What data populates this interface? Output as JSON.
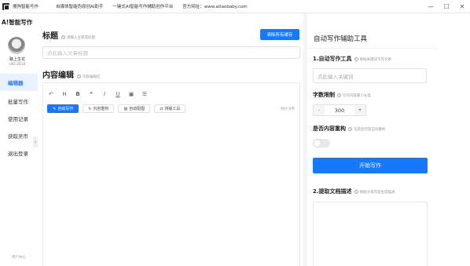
{
  "window": {
    "title": "搜狗智能写作",
    "nav": [
      "自媒体智能伪原创AI助手",
      "一键式AI智能写作辅助创作平台",
      "官方网址：www.aitaobaby.com"
    ],
    "controls": {
      "minimize": "—",
      "maximize": "☐",
      "close": "✕"
    }
  },
  "sidebar": {
    "brand": "A!智能写作",
    "user": {
      "nickname": "路上生花",
      "uid": "UID:2810"
    },
    "items": [
      {
        "label": "编辑器",
        "active": true
      },
      {
        "label": "批量写作",
        "active": false
      },
      {
        "label": "使用记录",
        "active": false
      },
      {
        "label": "获取灵币",
        "active": false
      },
      {
        "label": "退出登录",
        "active": false
      }
    ],
    "user_center": "用户中心",
    "collapse_arrow": "‹"
  },
  "editor_panel": {
    "title_heading": "标题",
    "title_hint": "请输入主题或标题",
    "clear_cache_label": "清除所有缓存",
    "title_placeholder": "点此输入文章标题",
    "content_heading": "内容编辑",
    "content_hint": "内容编辑区",
    "toolbar_icons": [
      "undo-icon",
      "heading-icon",
      "bold-icon",
      "quote-icon",
      "italic-icon",
      "underline-icon",
      "image-icon",
      "list-icon"
    ],
    "toolbar_glyphs": [
      "↶",
      "H",
      "B",
      "❝",
      "I",
      "U",
      "▣",
      "☰"
    ],
    "tools": [
      {
        "label": "自动写作",
        "icon": "✎",
        "primary": true
      },
      {
        "label": "内容重构",
        "icon": "↻",
        "primary": false
      },
      {
        "label": "自动配图",
        "icon": "▨",
        "primary": false
      },
      {
        "label": "排版工具",
        "icon": "⇄",
        "primary": false
      }
    ],
    "char_count": "共计:0字"
  },
  "assist_panel": {
    "title": "自动写作辅助工具",
    "section1": {
      "title": "1.自动写作工具",
      "hint": "根据关键词写作文章"
    },
    "keyword_placeholder": "点此输入关键词",
    "word_limit": {
      "title": "字数限制",
      "hint": "写作内容最小长度",
      "value": "300",
      "minus": "-",
      "plus": "+"
    },
    "rewrite": {
      "title": "是否内容重构",
      "hint": "勾选后内容自动重构",
      "enabled": false
    },
    "start_label": "开始写作",
    "section2": {
      "title": "2.提取文档描述",
      "hint": "根据文章内容生成描述"
    }
  },
  "colors": {
    "primary": "#1677ff",
    "active_bg": "#e8f1fd"
  }
}
